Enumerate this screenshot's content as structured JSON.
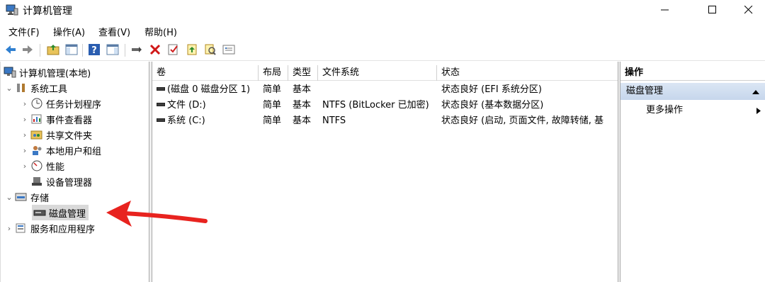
{
  "window": {
    "title": "计算机管理"
  },
  "menu": [
    "文件(F)",
    "操作(A)",
    "查看(V)",
    "帮助(H)"
  ],
  "tree": {
    "root": "计算机管理(本地)",
    "system_tools": "系统工具",
    "task_scheduler": "任务计划程序",
    "event_viewer": "事件查看器",
    "shared_folders": "共享文件夹",
    "local_users": "本地用户和组",
    "performance": "性能",
    "device_manager": "设备管理器",
    "storage": "存储",
    "disk_management": "磁盘管理",
    "services_apps": "服务和应用程序"
  },
  "table": {
    "columns": [
      "卷",
      "布局",
      "类型",
      "文件系统",
      "状态"
    ],
    "rows": [
      {
        "volume": "(磁盘 0 磁盘分区 1)",
        "layout": "简单",
        "type": "基本",
        "fs": "",
        "status": "状态良好 (EFI 系统分区)"
      },
      {
        "volume": "文件 (D:)",
        "layout": "简单",
        "type": "基本",
        "fs": "NTFS (BitLocker 已加密)",
        "status": "状态良好 (基本数据分区)"
      },
      {
        "volume": "系统 (C:)",
        "layout": "简单",
        "type": "基本",
        "fs": "NTFS",
        "status": "状态良好 (启动, 页面文件, 故障转储, 基"
      }
    ]
  },
  "actions": {
    "header": "操作",
    "section": "磁盘管理",
    "more": "更多操作"
  },
  "colors": {
    "arrow": "#e8231f",
    "selection": "#d9d9d9",
    "action_section": "#cfdcef"
  }
}
